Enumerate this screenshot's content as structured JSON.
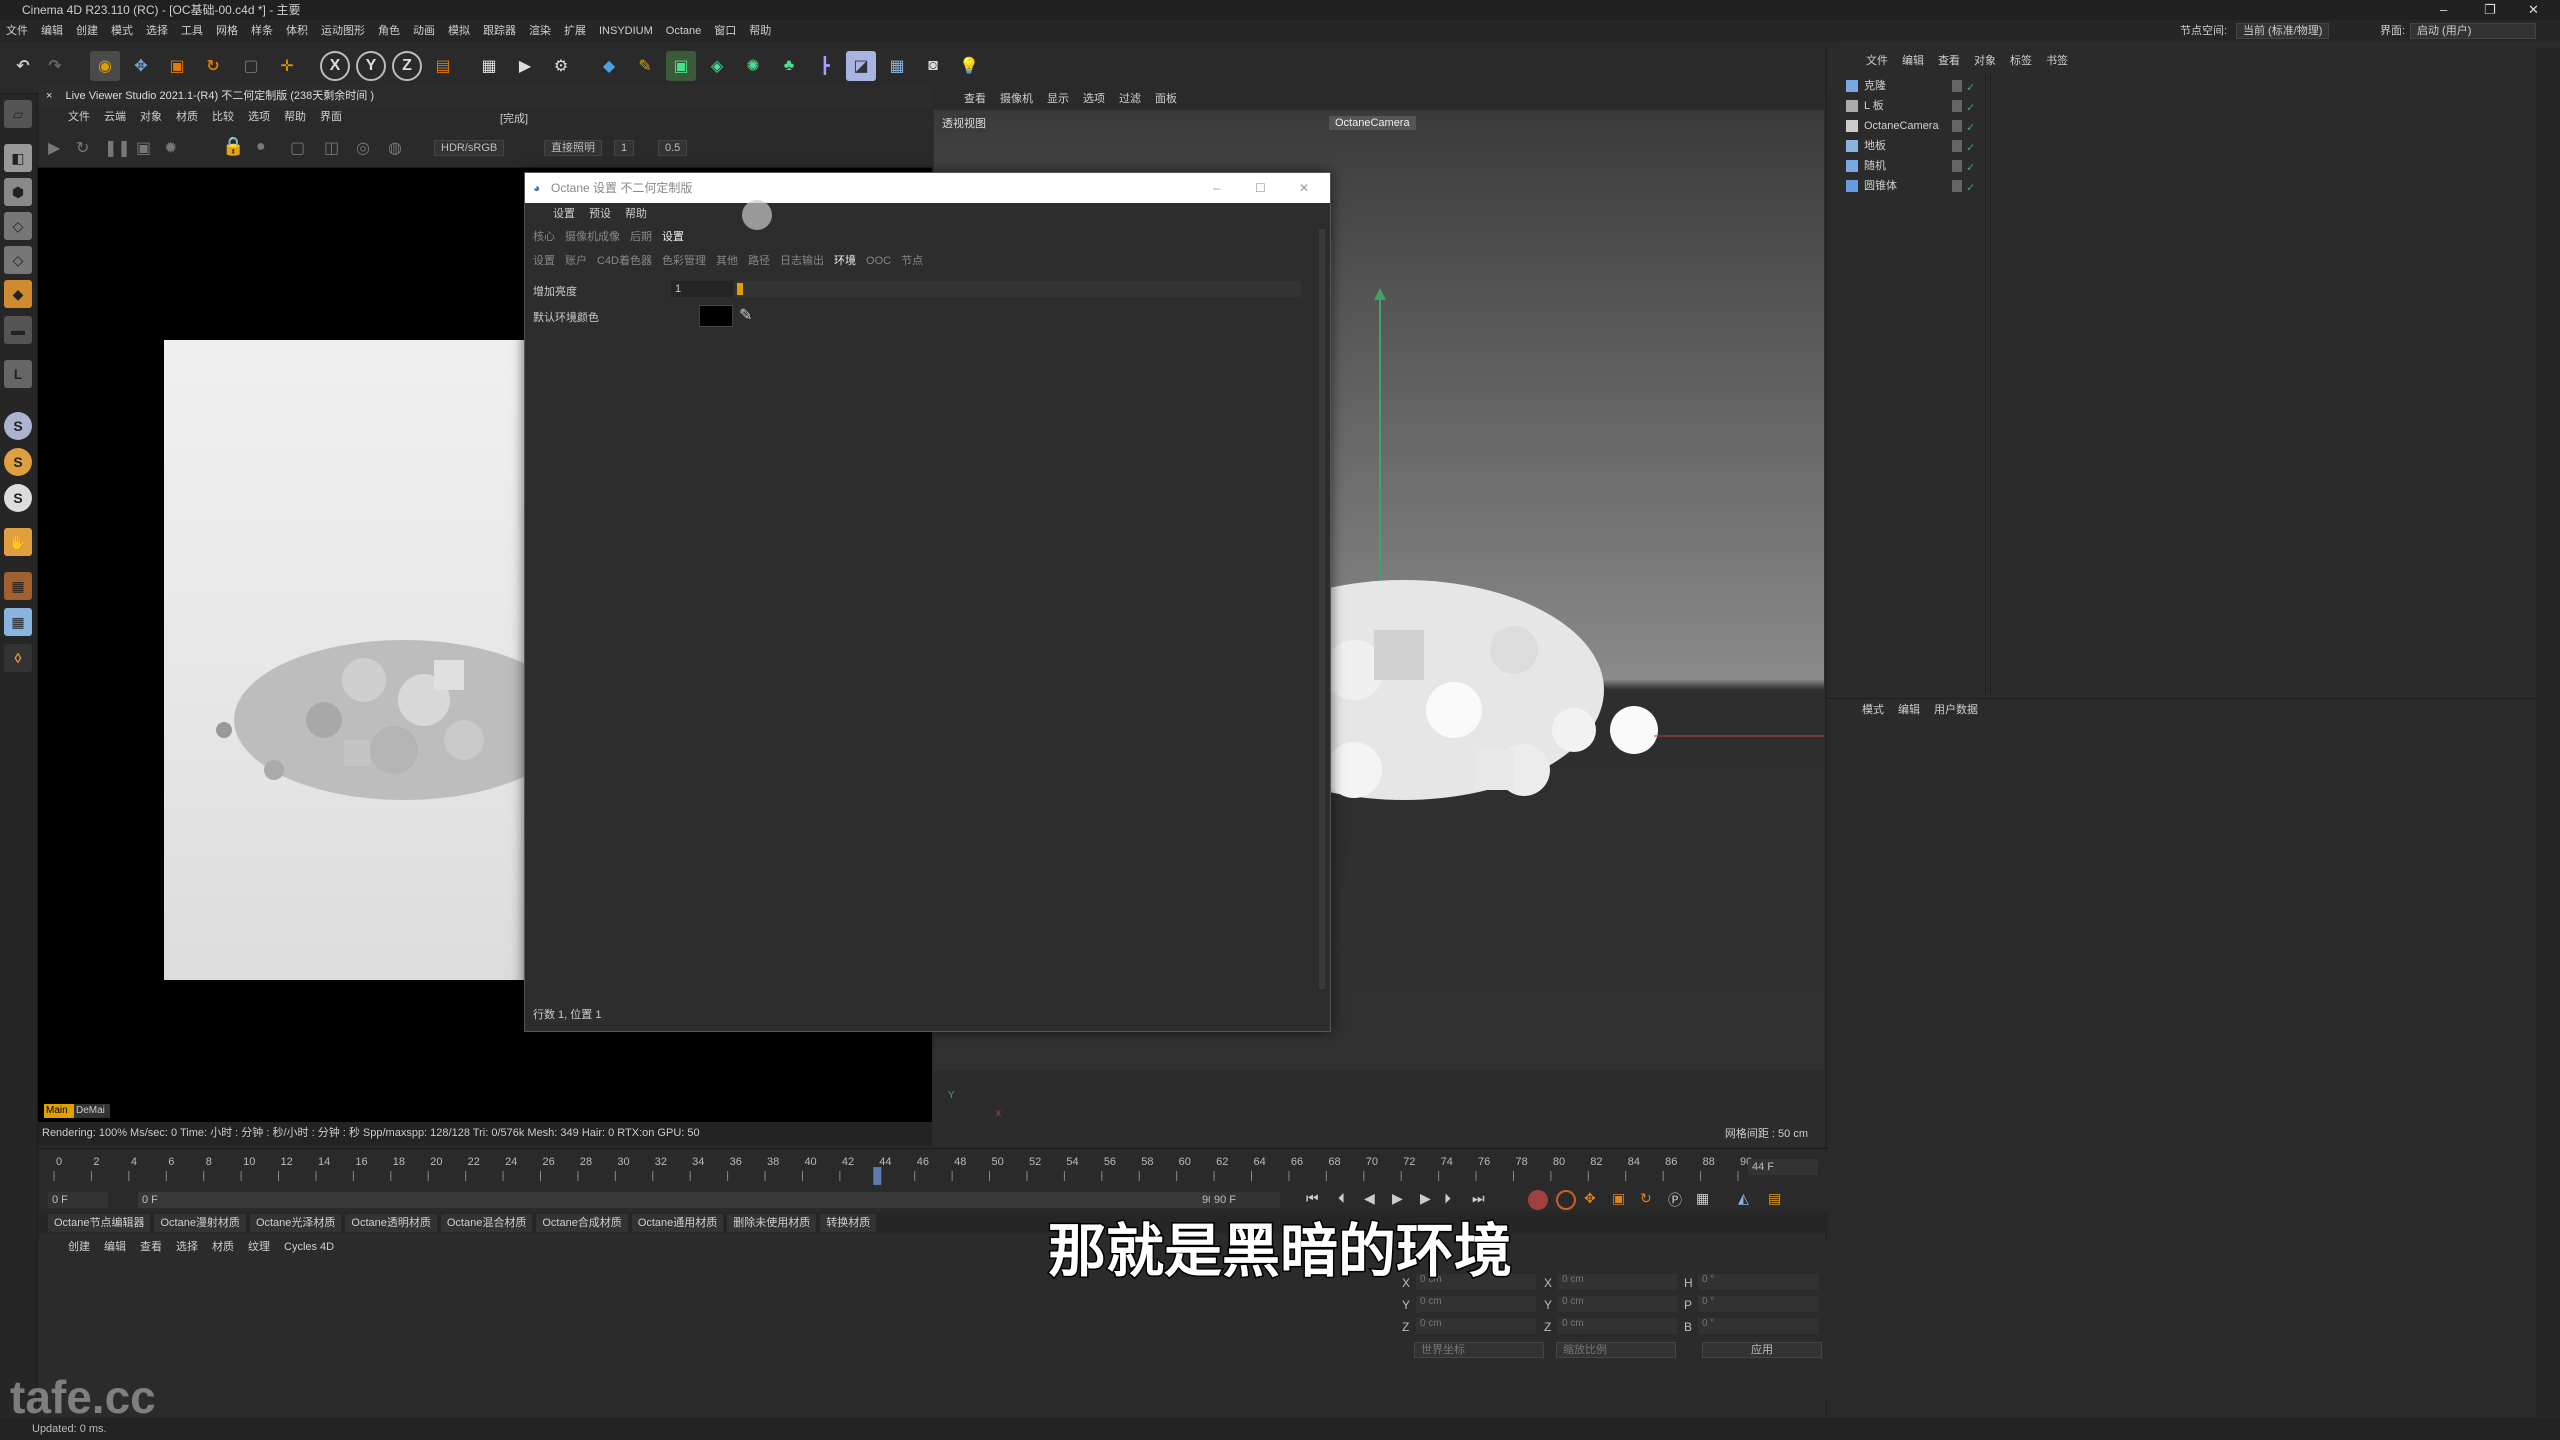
{
  "window": {
    "title": "Cinema 4D R23.110 (RC) - [OC基础-00.c4d *] - 主要"
  },
  "menubar": {
    "items": [
      "文件",
      "编辑",
      "创建",
      "模式",
      "选择",
      "工具",
      "网格",
      "样条",
      "体积",
      "运动图形",
      "角色",
      "动画",
      "模拟",
      "跟踪器",
      "渲染",
      "扩展",
      "INSYDIUM",
      "Octane",
      "窗口",
      "帮助"
    ],
    "node_space_label": "节点空间:",
    "node_space_value": "当前 (标准/物理)",
    "layout_label": "界面:",
    "layout_value": "启动 (用户)"
  },
  "toolbar": {
    "axis_x": "X",
    "axis_y": "Y",
    "axis_z": "Z"
  },
  "live_viewer": {
    "title": "Live Viewer Studio 2021.1-(R4)  不二何定制版 (238天剩余时间 )",
    "menu": [
      "文件",
      "云端",
      "对象",
      "材质",
      "比较",
      "选项",
      "帮助",
      "界面"
    ],
    "status_tag": "[完成]",
    "color_space": "HDR/sRGB",
    "mode": "直接照明",
    "value_a": "1",
    "value_b": "0.5",
    "bottom_tag": "Main",
    "bottom_tag2": "DeMai",
    "status": "Rendering: 100%   Ms/sec: 0   Time: 小时 : 分钟 : 秒/小时 : 分钟 : 秒   Spp/maxspp: 128/128   Tri: 0/576k   Mesh: 349  Hair: 0   RTX:on   GPU:   50"
  },
  "viewport": {
    "menu": [
      "查看",
      "摄像机",
      "显示",
      "选项",
      "过滤",
      "面板"
    ],
    "label": "透视视图",
    "camera": "OctaneCamera",
    "grid_info": "网格间距 : 50 cm"
  },
  "dialog": {
    "title": "Octane 设置  不二何定制版",
    "menu": [
      "设置",
      "预设",
      "帮助"
    ],
    "tabs_row1": [
      "核心",
      "摄像机成像",
      "后期",
      "设置"
    ],
    "tabs_row2": [
      "设置",
      "账户",
      "C4D着色器",
      "色彩管理",
      "其他",
      "路径",
      "日志输出",
      "环境",
      "OOC",
      "节点"
    ],
    "field1_label": "增加亮度",
    "field1_value": "1",
    "field2_label": "默认环境颜色",
    "footer": "行数 1,  位置 1"
  },
  "objects": {
    "menu": [
      "文件",
      "编辑",
      "查看",
      "对象",
      "标签",
      "书签"
    ],
    "items": [
      "克隆",
      "L 板",
      "OctaneCamera",
      "地板",
      "随机",
      "圆锥体"
    ]
  },
  "attributes": {
    "menu": [
      "模式",
      "编辑",
      "用户数据"
    ]
  },
  "timeline": {
    "ticks": [
      "0",
      "2",
      "4",
      "6",
      "8",
      "10",
      "12",
      "14",
      "16",
      "18",
      "20",
      "22",
      "24",
      "26",
      "28",
      "30",
      "32",
      "34",
      "36",
      "38",
      "40",
      "42",
      "44",
      "46",
      "48",
      "50",
      "52",
      "54",
      "56",
      "58",
      "60",
      "62",
      "64",
      "66",
      "68",
      "70",
      "72",
      "74",
      "76",
      "78",
      "80",
      "82",
      "84",
      "86",
      "88",
      "90"
    ],
    "current_frame": "44 F",
    "start": "0 F",
    "start2": "0 F",
    "end": "90 F",
    "end2": "90 F"
  },
  "material_tabs": [
    "Octane节点编辑器",
    "Octane漫射材质",
    "Octane光泽材质",
    "Octane透明材质",
    "Octane混合材质",
    "Octane合成材质",
    "Octane通用材质",
    "删除未使用材质",
    "转换材质"
  ],
  "material_menu": [
    "创建",
    "编辑",
    "查看",
    "选择",
    "材质",
    "纹理",
    "Cycles 4D"
  ],
  "coordinates": {
    "x": "X",
    "y": "Y",
    "z": "Z",
    "h": "H",
    "p": "P",
    "b": "B",
    "pos_x": "0 cm",
    "pos_y": "0 cm",
    "pos_z": "0 cm",
    "size_x": "0 cm",
    "size_y": "0 cm",
    "size_z": "0 cm",
    "rot_h": "0 °",
    "rot_p": "0 °",
    "rot_b": "0 °",
    "mode1": "世界坐标",
    "mode2": "缩放比例",
    "apply": "应用"
  },
  "statusbar": {
    "text": "Updated: 0 ms."
  },
  "subtitle": "那就是黑暗的环境",
  "watermark": "tafe.cc"
}
